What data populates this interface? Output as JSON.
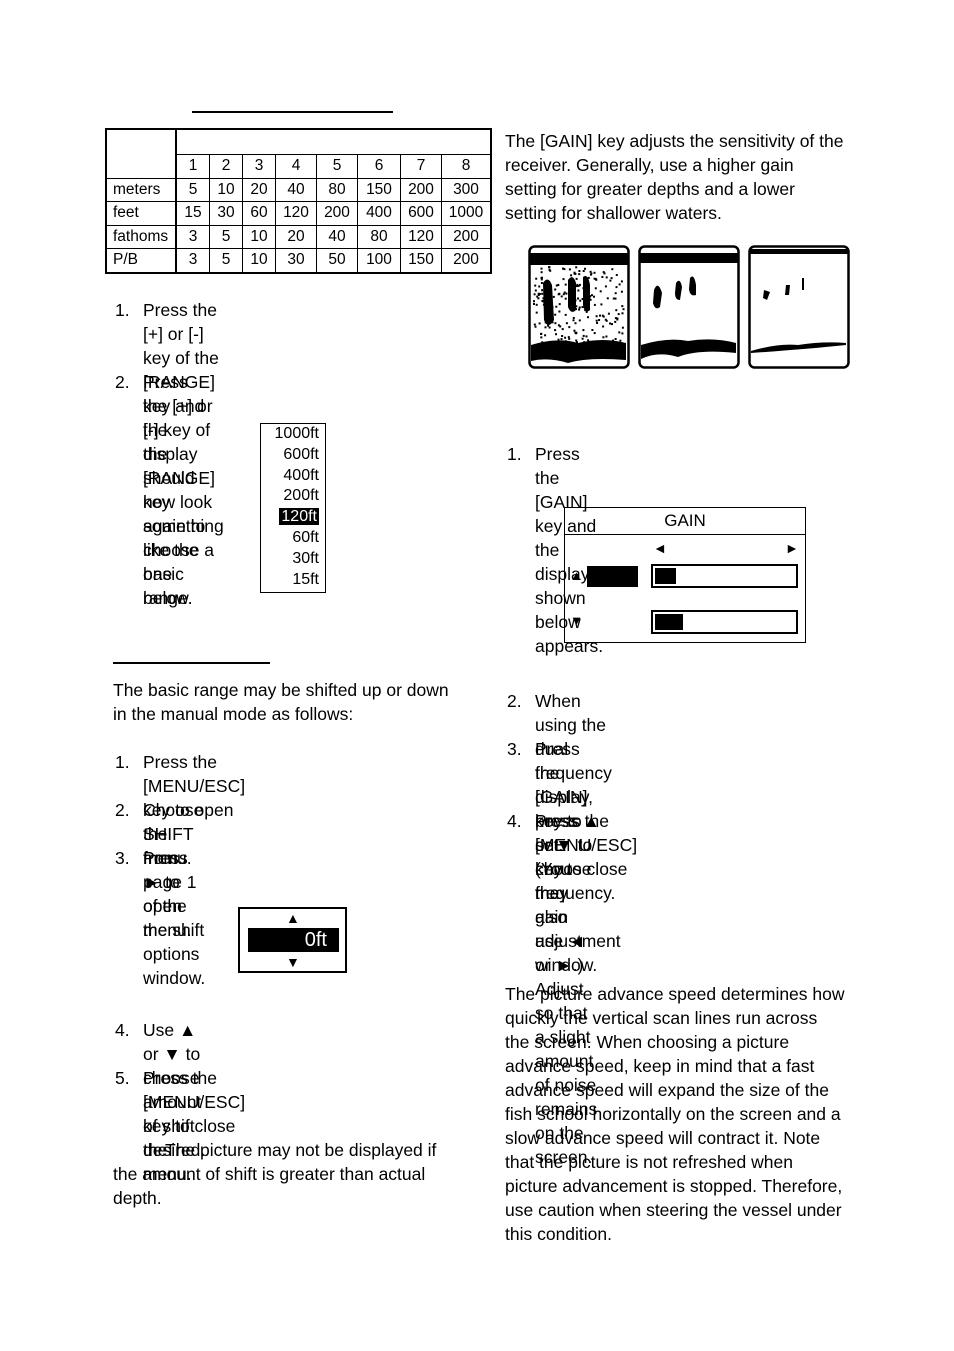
{
  "range_table": {
    "columns": [
      "1",
      "2",
      "3",
      "4",
      "5",
      "6",
      "7",
      "8"
    ],
    "rows": [
      {
        "unit": "meters",
        "values": [
          "5",
          "10",
          "20",
          "40",
          "80",
          "150",
          "200",
          "300"
        ]
      },
      {
        "unit": "feet",
        "values": [
          "15",
          "30",
          "60",
          "120",
          "200",
          "400",
          "600",
          "1000"
        ]
      },
      {
        "unit": "fathoms",
        "values": [
          "3",
          "5",
          "10",
          "20",
          "40",
          "80",
          "120",
          "200"
        ]
      },
      {
        "unit": "P/B",
        "values": [
          "3",
          "5",
          "10",
          "30",
          "50",
          "100",
          "150",
          "200"
        ]
      }
    ]
  },
  "range_steps": [
    {
      "n": "1.",
      "text": "Press the [+] or [-] key of the [RANGE]\nkey and the display should now look\nsomething like the one below."
    },
    {
      "n": "2.",
      "text": "Press the [+] or [-] key of the [RANGE]\nkey again to choose a basic range."
    }
  ],
  "range_list": {
    "items": [
      "1000ft",
      "600ft",
      "400ft",
      "200ft",
      "120ft",
      "60ft",
      "30ft",
      "15ft"
    ],
    "selected": "120ft"
  },
  "shift_intro": "The basic range may be shifted up or down\nin the manual mode as follows:",
  "shift_steps": [
    {
      "n": "1.",
      "text": "Press the [MENU/ESC] key to open the\nmenu."
    },
    {
      "n": "2.",
      "text": "Choose SHIFT from page 1 of the\nmenu."
    },
    {
      "n": "3.",
      "text": "Press ► to open the shift options\nwindow."
    }
  ],
  "shift_window": {
    "up": "▲",
    "value": "0ft",
    "down": "▼"
  },
  "shift_steps2": [
    {
      "n": "4.",
      "text": "Use ▲ or ▼ to choose amount of shift\ndesired."
    },
    {
      "n": "5.",
      "text": "Press the [MENU/ESC] key to close the\nmenu."
    }
  ],
  "shift_note": "The picture may not be displayed if\nthe amount of shift is greater than actual\ndepth.",
  "gain_intro": "The [GAIN] key adjusts the sensitivity of the\nreceiver. Generally, use a higher gain\nsetting for greater depths and a lower\nsetting for shallower waters.",
  "gain_steps": [
    {
      "n": "1.",
      "text": "Press the [GAIN] key and the display\nshown below appears."
    }
  ],
  "gain_window": {
    "title": "GAIN",
    "left": "◄",
    "right": "►",
    "up": "▲",
    "down": "▼",
    "level_high": 0.15,
    "level_low": 0.2
  },
  "gain_steps2": [
    {
      "n": "2.",
      "text": "When using the dual frequency display,\npress ▲ or ▼ to choose frequency."
    },
    {
      "n": "3.",
      "text": "Press the [GAIN] key to set. (You may\nalso use ◄ or ►.) Adjust so that a slight\namount of noise remains on the screen."
    },
    {
      "n": "4.",
      "text": "Press the [MENU/ESC] key to close the\ngain adjustment window."
    }
  ],
  "advance_text": "The picture advance speed determines how\nquickly the vertical scan lines run across\nthe screen. When choosing a picture\nadvance speed, keep in mind that a fast\nadvance speed will expand the size of the\nfish school horizontally on the screen and a\nslow advance speed will contract it. Note\nthat the picture is not refreshed when\npicture advancement is stopped. Therefore,\nuse caution when steering the vessel under\nthis condition."
}
